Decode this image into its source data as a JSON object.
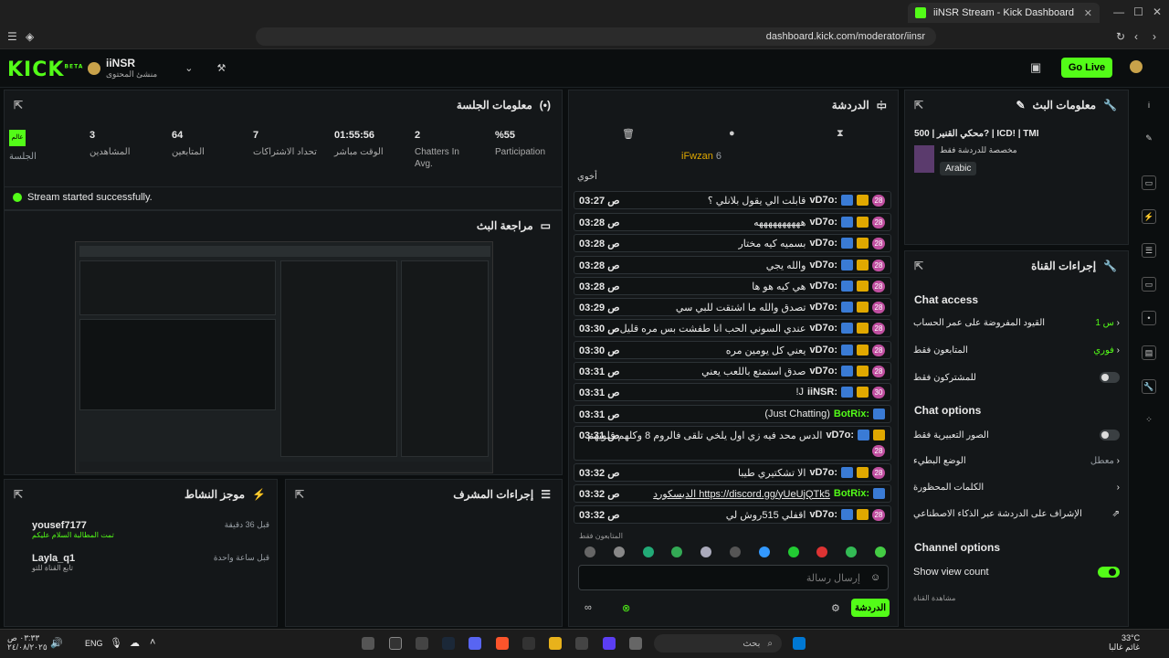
{
  "browser": {
    "tab_title": "iiNSR Stream - Kick Dashboard",
    "url": "dashboard.kick.com/moderator/iinsr"
  },
  "header": {
    "logo": "KICK",
    "logo_beta": "BETA",
    "username": "iiNSR",
    "role": "منشئ المحتوى",
    "golive": "Go Live"
  },
  "session": {
    "title": "معلومات الجلسة",
    "stats": [
      {
        "value": "%55",
        "label": "Participation"
      },
      {
        "value": "2",
        "label": "Chatters In Avg."
      },
      {
        "value": "01:55:56",
        "label": "الوقت مباشر"
      },
      {
        "value": "7",
        "label": "تحداد الاشتراكات"
      },
      {
        "value": "64",
        "label": "المتابعين"
      },
      {
        "value": "3",
        "label": "المشاهدين"
      }
    ],
    "session_badge": "عالم",
    "session_label": "الجلسة",
    "started": "Stream started successfully."
  },
  "preview": {
    "title": "مراجعة البث"
  },
  "activity": {
    "title": "موجز النشاط",
    "items": [
      {
        "user": "yousef7177",
        "text": "تمت المطالبة السلام عليكم",
        "time": "قبل 36 دقيقة"
      },
      {
        "user": "Layla_q1",
        "text": "تابع القناة للتو",
        "time": "قبل ساعة واحدة"
      }
    ]
  },
  "modactions": {
    "title": "إجراءات المشرف"
  },
  "chat": {
    "title": "الدردشة",
    "pinned_user": "iFwzan",
    "pinned_count": "6",
    "partial": "أخوي",
    "messages": [
      {
        "time": "03:27 ص",
        "user": "vD7o:",
        "text": "قابلت الي يقول بلانلي ؟",
        "badge": "28"
      },
      {
        "time": "03:28 ص",
        "user": "vD7o:",
        "text": "ههههههههههه",
        "badge": "28"
      },
      {
        "time": "03:28 ص",
        "user": "vD7o:",
        "text": "بسميه كيه مختار",
        "badge": "28"
      },
      {
        "time": "03:28 ص",
        "user": "vD7o:",
        "text": "والله يجي",
        "badge": "28"
      },
      {
        "time": "03:28 ص",
        "user": "vD7o:",
        "text": "هي كيه هو ها",
        "badge": "28"
      },
      {
        "time": "03:29 ص",
        "user": "vD7o:",
        "text": "تصدق والله ما اشتقت للبي سي",
        "badge": "28"
      },
      {
        "time": "03:30 ص",
        "user": "vD7o:",
        "text": "عندي السوني الحب انا طفشت بس مره قليل",
        "badge": "28"
      },
      {
        "time": "03:30 ص",
        "user": "vD7o:",
        "text": "يعني كل يومين مره",
        "badge": "28"
      },
      {
        "time": "03:31 ص",
        "user": "vD7o:",
        "text": "صدق استمتع باللعب يعني",
        "badge": "28"
      },
      {
        "time": "03:31 ص",
        "user": "iiNSR:",
        "text": "!J",
        "badge": "30"
      },
      {
        "time": "03:31 ص",
        "user": "BotRix:",
        "text": "(Just Chatting)",
        "badge": ""
      },
      {
        "time": "03:31 ص",
        "user": "vD7o:",
        "text": "الدس محد فيه زي اول يلخي تلقى فالروم 8 وكلهم قلويهم",
        "badge": "28",
        "extra": "على بعض"
      },
      {
        "time": "03:32 ص",
        "user": "vD7o:",
        "text": "الا تشكتيري طيبا",
        "badge": "28"
      },
      {
        "time": "03:32 ص",
        "user": "BotRix:",
        "text": "الديسكورد https://discord.gg/yUeUjQTk5",
        "badge": ""
      },
      {
        "time": "03:32 ص",
        "user": "vD7o:",
        "text": "اقفلي 515روش لي",
        "badge": "28"
      }
    ],
    "followers_only": "المتابعون فقط",
    "input_placeholder": "إرسال رسالة",
    "send": "الدردشة"
  },
  "streaminfo": {
    "title": "معلومات البث",
    "stream_title": "محكي القنير | 500? | ICD! | TMI",
    "category": "مخصصة للدردشة فقط",
    "language": "Arabic"
  },
  "actions": {
    "title": "إجراءات القناة",
    "chat_access": "Chat access",
    "rows1": [
      {
        "label": "القيود المفروضة على عمر الحساب",
        "value": "1 س"
      },
      {
        "label": "المتابعون فقط",
        "value": "فوري"
      },
      {
        "label": "للمشتركون فقط",
        "value": ""
      }
    ],
    "chat_options": "Chat options",
    "rows2": [
      {
        "label": "الصور التعبيرية فقط",
        "value": ""
      },
      {
        "label": "الوضع البطيء",
        "value": "معطل"
      },
      {
        "label": "الكلمات المحظورة",
        "value": ""
      },
      {
        "label": "الإشراف على الدردشة عبر الذكاء الاصطناعي",
        "value": ""
      }
    ],
    "channel_options": "Channel options",
    "show_view_count": "Show view count",
    "channel_watch": "مشاهدة القناة"
  },
  "taskbar": {
    "time": "٠٣:٣٣ ص",
    "date": "٢٤/٠٨/٢٠٢٥",
    "lang": "ENG",
    "search": "بحث",
    "weather_temp": "33°C",
    "weather_text": "غائم غالبا"
  },
  "colors": {
    "accent": "#53fc18",
    "panel": "#141719",
    "bg": "#0b0e0f"
  }
}
